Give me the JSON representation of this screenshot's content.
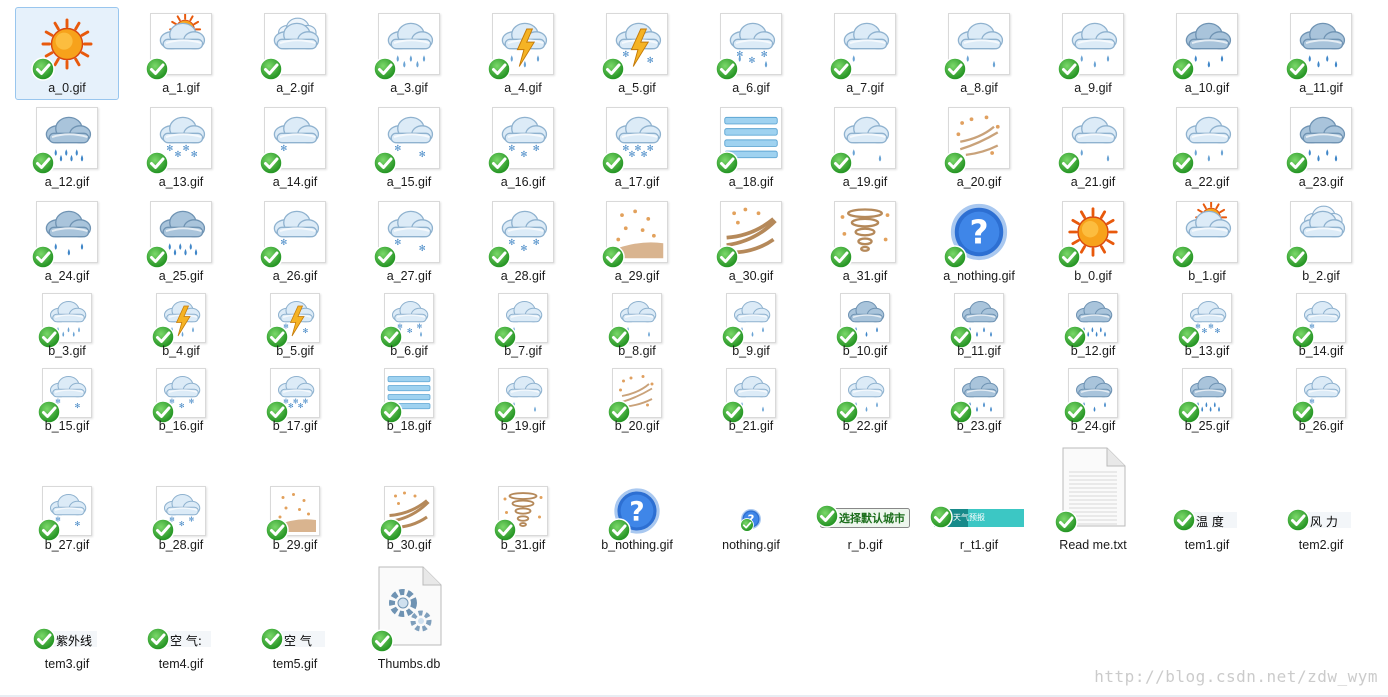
{
  "watermark": "http://blog.csdn.net/zdw_wym",
  "items": [
    {
      "label": "a_0.gif",
      "icon": "sun-icon",
      "selected": true
    },
    {
      "label": "a_1.gif",
      "icon": "sun-cloud-icon"
    },
    {
      "label": "a_2.gif",
      "icon": "cloud-icon"
    },
    {
      "label": "a_3.gif",
      "icon": "shower-rain-icon"
    },
    {
      "label": "a_4.gif",
      "icon": "thunderstorm-icon"
    },
    {
      "label": "a_5.gif",
      "icon": "thunder-hail-icon"
    },
    {
      "label": "a_6.gif",
      "icon": "sleet-icon"
    },
    {
      "label": "a_7.gif",
      "icon": "light-rain-icon"
    },
    {
      "label": "a_8.gif",
      "icon": "moderate-rain-icon"
    },
    {
      "label": "a_9.gif",
      "icon": "heavy-rain-icon"
    },
    {
      "label": "a_10.gif",
      "icon": "rainstorm-icon"
    },
    {
      "label": "a_11.gif",
      "icon": "heavy-rainstorm-icon"
    },
    {
      "label": "a_12.gif",
      "icon": "extreme-rainstorm-icon"
    },
    {
      "label": "a_13.gif",
      "icon": "snow-shower-icon"
    },
    {
      "label": "a_14.gif",
      "icon": "light-snow-icon"
    },
    {
      "label": "a_15.gif",
      "icon": "moderate-snow-icon"
    },
    {
      "label": "a_16.gif",
      "icon": "heavy-snow-icon"
    },
    {
      "label": "a_17.gif",
      "icon": "snowstorm-icon"
    },
    {
      "label": "a_18.gif",
      "icon": "fog-icon"
    },
    {
      "label": "a_19.gif",
      "icon": "freezing-rain-icon"
    },
    {
      "label": "a_20.gif",
      "icon": "sandstorm-icon"
    },
    {
      "label": "a_21.gif",
      "icon": "light-moderate-rain-icon"
    },
    {
      "label": "a_22.gif",
      "icon": "moderate-heavy-rain-icon"
    },
    {
      "label": "a_23.gif",
      "icon": "heavy-rainstorm-icon"
    },
    {
      "label": "a_24.gif",
      "icon": "rainstorm-icon"
    },
    {
      "label": "a_25.gif",
      "icon": "extreme-rainstorm-icon"
    },
    {
      "label": "a_26.gif",
      "icon": "light-snow-icon"
    },
    {
      "label": "a_27.gif",
      "icon": "moderate-snow-icon"
    },
    {
      "label": "a_28.gif",
      "icon": "heavy-snow-icon"
    },
    {
      "label": "a_29.gif",
      "icon": "dust-icon"
    },
    {
      "label": "a_30.gif",
      "icon": "blowing-sand-icon"
    },
    {
      "label": "a_31.gif",
      "icon": "strong-sandstorm-icon"
    },
    {
      "label": "a_nothing.gif",
      "icon": "question-icon"
    },
    {
      "label": "b_0.gif",
      "icon": "sun-icon"
    },
    {
      "label": "b_1.gif",
      "icon": "sun-cloud-icon"
    },
    {
      "label": "b_2.gif",
      "icon": "cloud-icon"
    },
    {
      "label": "b_3.gif",
      "icon": "shower-rain-icon"
    },
    {
      "label": "b_4.gif",
      "icon": "thunderstorm-icon"
    },
    {
      "label": "b_5.gif",
      "icon": "thunder-hail-icon"
    },
    {
      "label": "b_6.gif",
      "icon": "sleet-icon"
    },
    {
      "label": "b_7.gif",
      "icon": "light-rain-icon"
    },
    {
      "label": "b_8.gif",
      "icon": "moderate-rain-icon"
    },
    {
      "label": "b_9.gif",
      "icon": "heavy-rain-icon"
    },
    {
      "label": "b_10.gif",
      "icon": "rainstorm-icon"
    },
    {
      "label": "b_11.gif",
      "icon": "heavy-rainstorm-icon"
    },
    {
      "label": "b_12.gif",
      "icon": "extreme-rainstorm-icon"
    },
    {
      "label": "b_13.gif",
      "icon": "snow-shower-icon"
    },
    {
      "label": "b_14.gif",
      "icon": "light-snow-icon"
    },
    {
      "label": "b_15.gif",
      "icon": "moderate-snow-icon"
    },
    {
      "label": "b_16.gif",
      "icon": "heavy-snow-icon"
    },
    {
      "label": "b_17.gif",
      "icon": "snowstorm-icon"
    },
    {
      "label": "b_18.gif",
      "icon": "fog-icon"
    },
    {
      "label": "b_19.gif",
      "icon": "freezing-rain-icon"
    },
    {
      "label": "b_20.gif",
      "icon": "sandstorm-icon"
    },
    {
      "label": "b_21.gif",
      "icon": "light-moderate-rain-icon"
    },
    {
      "label": "b_22.gif",
      "icon": "moderate-heavy-rain-icon"
    },
    {
      "label": "b_23.gif",
      "icon": "heavy-rainstorm-icon"
    },
    {
      "label": "b_24.gif",
      "icon": "rainstorm-icon"
    },
    {
      "label": "b_25.gif",
      "icon": "extreme-rainstorm-icon"
    },
    {
      "label": "b_26.gif",
      "icon": "light-snow-icon"
    },
    {
      "label": "b_27.gif",
      "icon": "moderate-snow-icon"
    },
    {
      "label": "b_28.gif",
      "icon": "heavy-snow-icon"
    },
    {
      "label": "b_29.gif",
      "icon": "dust-icon"
    },
    {
      "label": "b_30.gif",
      "icon": "blowing-sand-icon"
    },
    {
      "label": "b_31.gif",
      "icon": "strong-sandstorm-icon"
    },
    {
      "label": "b_nothing.gif",
      "icon": "question-icon"
    },
    {
      "label": "nothing.gif",
      "icon": "question-icon"
    },
    {
      "label": "r_b.gif",
      "icon": "select-city-button-icon",
      "overlay": "选择默认城市"
    },
    {
      "label": "r_t1.gif",
      "icon": "forecast-bar-icon",
      "overlay": "天气预报"
    },
    {
      "label": "Read me.txt",
      "icon": "text-file-icon"
    },
    {
      "label": "tem1.gif",
      "icon": "temperature-label-icon",
      "overlay": "温  度"
    },
    {
      "label": "tem2.gif",
      "icon": "wind-label-icon",
      "overlay": "风  力"
    },
    {
      "label": "tem3.gif",
      "icon": "uv-label-icon",
      "overlay": "紫外线"
    },
    {
      "label": "tem4.gif",
      "icon": "air-label-icon",
      "overlay": "空  气:"
    },
    {
      "label": "tem5.gif",
      "icon": "air-label-icon",
      "overlay": "空  气"
    },
    {
      "label": "Thumbs.db",
      "icon": "gear-file-icon"
    }
  ]
}
